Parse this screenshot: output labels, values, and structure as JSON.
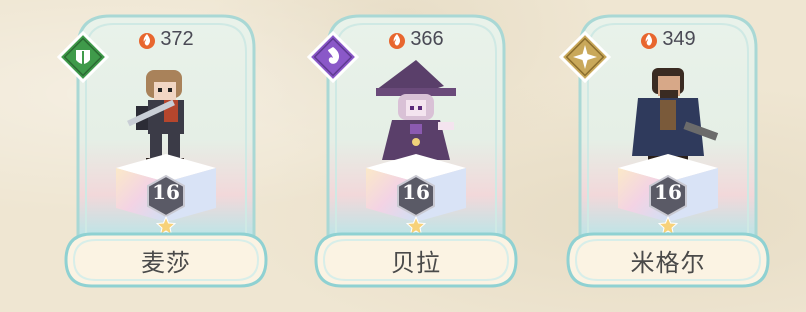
{
  "cards": [
    {
      "name": "麦莎",
      "power": "372",
      "level": "16",
      "class_icon": "shield-class-icon",
      "class_color": "#3f9a4a",
      "hero_colors": {
        "hair": "#a9825a",
        "armor": "#3b3b47",
        "accent": "#b5462d",
        "blade": "#c9ced6"
      }
    },
    {
      "name": "贝拉",
      "power": "366",
      "level": "16",
      "class_icon": "arcane-class-icon",
      "class_color": "#8a58c8",
      "hero_colors": {
        "hair": "#d9c1d6",
        "armor": "#5a3f6a",
        "accent": "#8b5ab0",
        "blade": "#f0d27a"
      }
    },
    {
      "name": "米格尔",
      "power": "349",
      "level": "16",
      "class_icon": "star-class-icon",
      "class_color": "#c9a85a",
      "hero_colors": {
        "hair": "#3a2b22",
        "armor": "#2f3a5c",
        "accent": "#7a5a3a",
        "blade": "#6b6b6b"
      }
    }
  ]
}
